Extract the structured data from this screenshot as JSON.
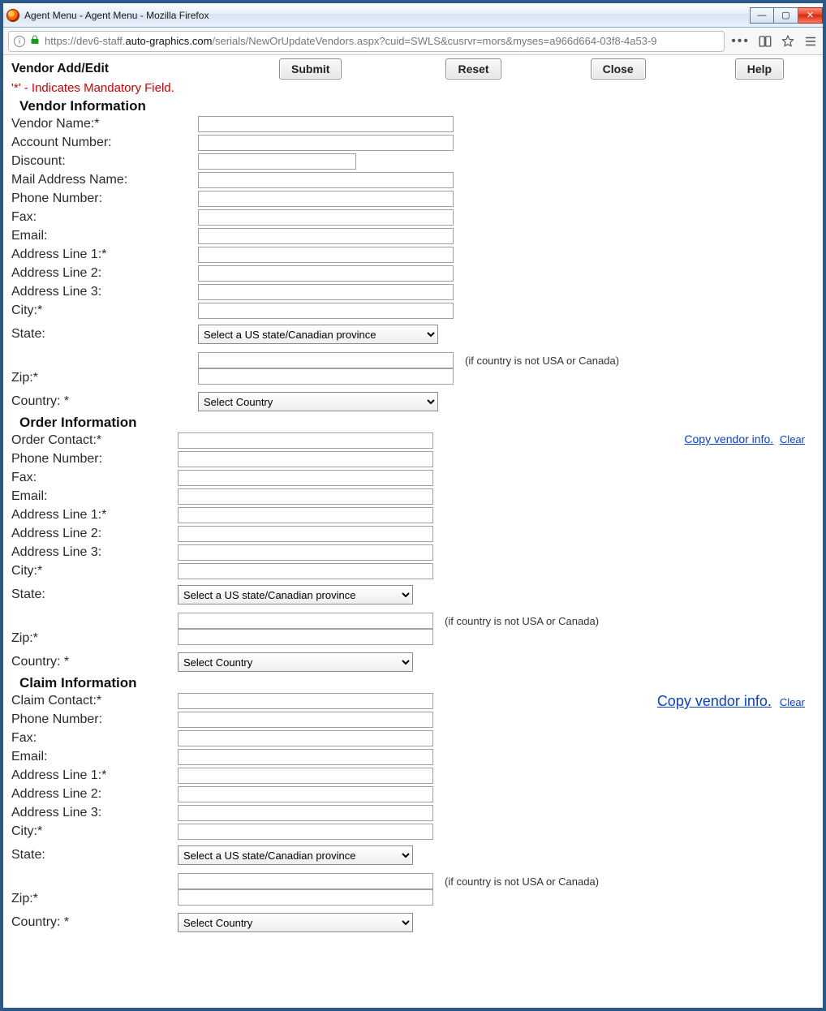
{
  "window_title": "Agent Menu - Agent Menu - Mozilla Firefox",
  "url_pre": "https://dev6-staff.",
  "url_host": "auto-graphics.com",
  "url_post": "/serials/NewOrUpdateVendors.aspx?cuid=SWLS&cusrvr=mors&myses=a966d664-03f8-4a53-9",
  "page_title": "Vendor Add/Edit",
  "buttons": {
    "submit": "Submit",
    "reset": "Reset",
    "close": "Close",
    "help": "Help"
  },
  "mandatory_note": "'*' - Indicates Mandatory Field.",
  "state_placeholder": "Select a US state/Canadian province",
  "country_placeholder": "Select Country",
  "alt_region_hint": "(if country is not USA or Canada)",
  "links": {
    "copy": "Copy vendor info.",
    "clear": "Clear"
  },
  "vendor": {
    "head": "Vendor Information",
    "fields": {
      "name": "Vendor Name:*",
      "acct": "Account Number:",
      "discount": "Discount:",
      "mail_addr_name": "Mail Address Name:",
      "phone": "Phone Number:",
      "fax": "Fax:",
      "email": "Email:",
      "addr1": "Address Line 1:*",
      "addr2": "Address Line 2:",
      "addr3": "Address Line 3:",
      "city": "City:*",
      "state": "State:",
      "zip": "Zip:*",
      "country": "Country: *"
    }
  },
  "order": {
    "head": "Order Information",
    "fields": {
      "contact": "Order Contact:*",
      "phone": "Phone Number:",
      "fax": "Fax:",
      "email": "Email:",
      "addr1": "Address Line 1:*",
      "addr2": "Address Line 2:",
      "addr3": "Address Line 3:",
      "city": "City:*",
      "state": "State:",
      "zip": "Zip:*",
      "country": "Country: *"
    }
  },
  "claim": {
    "head": "Claim Information",
    "fields": {
      "contact": "Claim Contact:*",
      "phone": "Phone Number:",
      "fax": "Fax:",
      "email": "Email:",
      "addr1": "Address Line 1:*",
      "addr2": "Address Line 2:",
      "addr3": "Address Line 3:",
      "city": "City:*",
      "state": "State:",
      "zip": "Zip:*",
      "country": "Country: *"
    }
  }
}
